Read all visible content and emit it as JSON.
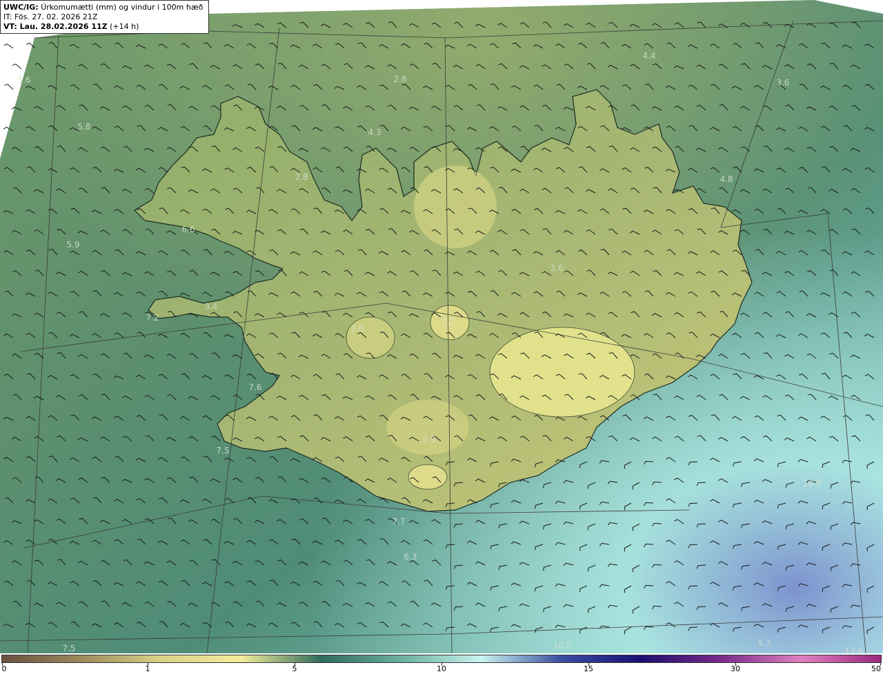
{
  "header": {
    "code": "UWC/IG:",
    "title": "Úrkomumætti (mm) og vindur i 100m hæð",
    "issue_time": "IT: Fös. 27. 02. 2026 21Z",
    "valid_label": "VT: Lau. 28.02.2026 11Z",
    "lead": "(+14 h)"
  },
  "colorbar": {
    "ticks": [
      "0",
      "1",
      "5",
      "10",
      "15",
      "30",
      "50"
    ],
    "colors": [
      "#6b5040",
      "#9c8a5c",
      "#d8d486",
      "#f2ec9a",
      "#2f6b5a",
      "#6ab0a0",
      "#c8f4f0",
      "#3a4ea0",
      "#1a1070",
      "#7a2a8a",
      "#e080c0",
      "#9a2a80"
    ]
  },
  "map_labels": [
    {
      "text": "5.6"
    },
    {
      "text": "5.8"
    },
    {
      "text": "2.8"
    },
    {
      "text": "4.4"
    },
    {
      "text": "3.6"
    },
    {
      "text": "4.3"
    },
    {
      "text": "2.8"
    },
    {
      "text": "4.8"
    },
    {
      "text": "6.6"
    },
    {
      "text": "5.9"
    },
    {
      "text": "3.6"
    },
    {
      "text": "3.4"
    },
    {
      "text": "7.2"
    },
    {
      "text": "2.0"
    },
    {
      "text": "1.1"
    },
    {
      "text": "7.6"
    },
    {
      "text": "7.5"
    },
    {
      "text": "2.9"
    },
    {
      "text": "7.7"
    },
    {
      "text": "6.3"
    },
    {
      "text": "10.0"
    },
    {
      "text": "10.5"
    },
    {
      "text": "9.3"
    },
    {
      "text": "7.5"
    },
    {
      "text": "12.6"
    }
  ]
}
